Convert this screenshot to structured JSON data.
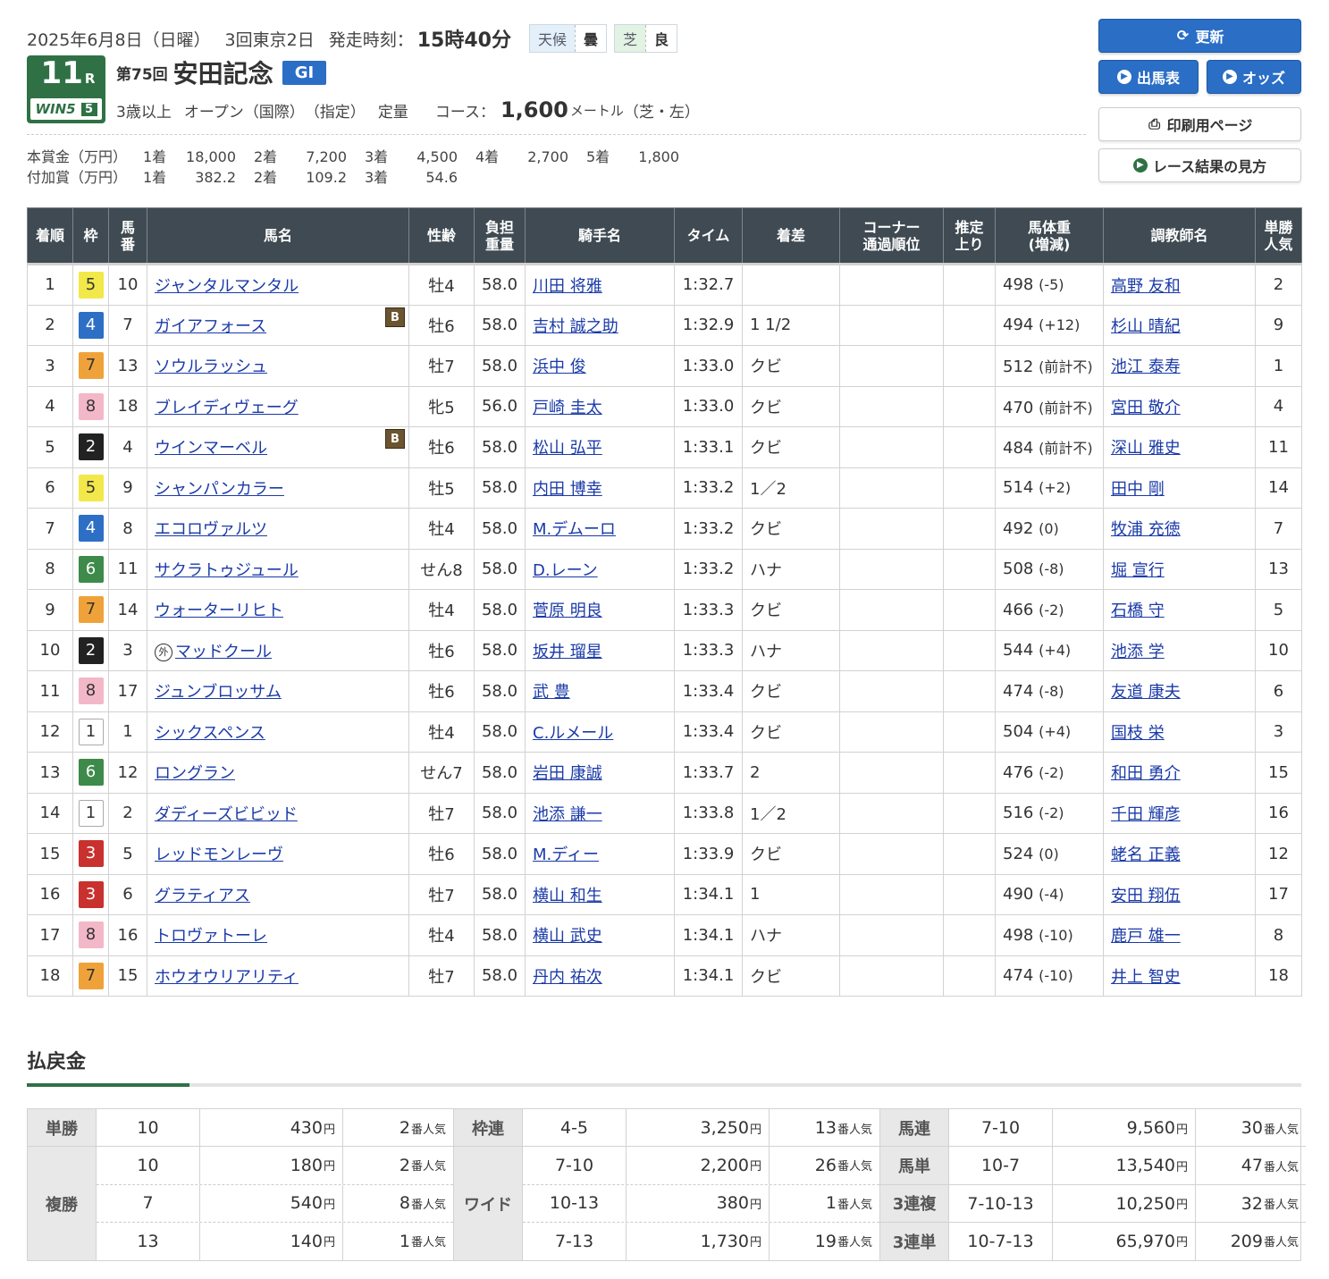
{
  "header": {
    "date": "2025年6月8日（日曜）",
    "kaisai": "3回東京2日",
    "post_label": "発走時刻：",
    "post_time": "15時40分",
    "weather_label": "天候",
    "weather_value": "曇",
    "track_label": "芝",
    "track_value": "良",
    "race_number": "11",
    "race_suffix": "R",
    "win5_label": "WIN5",
    "win5_index": "5",
    "race_kai": "第75回",
    "race_name": "安田記念",
    "grade": "GI",
    "cond_age": "3歳以上",
    "cond_class": "オープン",
    "cond_intl": "（国際）",
    "cond_shitei": "（指定）",
    "cond_weight": "定量",
    "course_label": "コース：",
    "course_distance": "1,600",
    "course_unit": "メートル",
    "course_detail": "（芝・左）"
  },
  "prize": {
    "main_label": "本賞金（万円）",
    "main": [
      {
        "place": "1着",
        "value": "18,000"
      },
      {
        "place": "2着",
        "value": "7,200"
      },
      {
        "place": "3着",
        "value": "4,500"
      },
      {
        "place": "4着",
        "value": "2,700"
      },
      {
        "place": "5着",
        "value": "1,800"
      }
    ],
    "extra_label": "付加賞（万円）",
    "extra": [
      {
        "place": "1着",
        "value": "382.2"
      },
      {
        "place": "2着",
        "value": "109.2"
      },
      {
        "place": "3着",
        "value": "54.6"
      }
    ]
  },
  "buttons": {
    "refresh": "更新",
    "entries": "出馬表",
    "odds": "オッズ",
    "print": "印刷用ページ",
    "guide": "レース結果の見方"
  },
  "table": {
    "headers": {
      "rank": "着順",
      "waku": "枠",
      "umaban_1": "馬",
      "umaban_2": "番",
      "horse": "馬名",
      "sexage": "性齢",
      "weight_1": "負担",
      "weight_2": "重量",
      "jockey": "騎手名",
      "time": "タイム",
      "margin": "着差",
      "corner_1": "コーナー",
      "corner_2": "通過順位",
      "last3f_1": "推定",
      "last3f_2": "上り",
      "body_1": "馬体重",
      "body_2": "(増減)",
      "trainer": "調教師名",
      "pop_1": "単勝",
      "pop_2": "人気"
    },
    "rows": [
      {
        "rank": "1",
        "waku": "5",
        "num": "10",
        "horse": "ジャンタルマンタル",
        "blinker": "",
        "foreign": "",
        "sexage": "牡4",
        "kg": "58.0",
        "jockey": "川田 将雅",
        "time": "1:32.7",
        "margin": "",
        "corner": "",
        "last3f": "",
        "body": "498",
        "diff": "(-5)",
        "trainer": "高野 友和",
        "pop": "2"
      },
      {
        "rank": "2",
        "waku": "4",
        "num": "7",
        "horse": "ガイアフォース",
        "blinker": "B",
        "foreign": "",
        "sexage": "牡6",
        "kg": "58.0",
        "jockey": "吉村 誠之助",
        "time": "1:32.9",
        "margin": "1 1/2",
        "corner": "",
        "last3f": "",
        "body": "494",
        "diff": "(+12)",
        "trainer": "杉山 晴紀",
        "pop": "9"
      },
      {
        "rank": "3",
        "waku": "7",
        "num": "13",
        "horse": "ソウルラッシュ",
        "blinker": "",
        "foreign": "",
        "sexage": "牡7",
        "kg": "58.0",
        "jockey": "浜中 俊",
        "time": "1:33.0",
        "margin": "クビ",
        "corner": "",
        "last3f": "",
        "body": "512",
        "diff": "(前計不)",
        "trainer": "池江 泰寿",
        "pop": "1"
      },
      {
        "rank": "4",
        "waku": "8",
        "num": "18",
        "horse": "ブレイディヴェーグ",
        "blinker": "",
        "foreign": "",
        "sexage": "牝5",
        "kg": "56.0",
        "jockey": "戸崎 圭太",
        "time": "1:33.0",
        "margin": "クビ",
        "corner": "",
        "last3f": "",
        "body": "470",
        "diff": "(前計不)",
        "trainer": "宮田 敬介",
        "pop": "4"
      },
      {
        "rank": "5",
        "waku": "2",
        "num": "4",
        "horse": "ウインマーベル",
        "blinker": "B",
        "foreign": "",
        "sexage": "牡6",
        "kg": "58.0",
        "jockey": "松山 弘平",
        "time": "1:33.1",
        "margin": "クビ",
        "corner": "",
        "last3f": "",
        "body": "484",
        "diff": "(前計不)",
        "trainer": "深山 雅史",
        "pop": "11"
      },
      {
        "rank": "6",
        "waku": "5",
        "num": "9",
        "horse": "シャンパンカラー",
        "blinker": "",
        "foreign": "",
        "sexage": "牡5",
        "kg": "58.0",
        "jockey": "内田 博幸",
        "time": "1:33.2",
        "margin": "1／2",
        "corner": "",
        "last3f": "",
        "body": "514",
        "diff": "(+2)",
        "trainer": "田中 剛",
        "pop": "14"
      },
      {
        "rank": "7",
        "waku": "4",
        "num": "8",
        "horse": "エコロヴァルツ",
        "blinker": "",
        "foreign": "",
        "sexage": "牡4",
        "kg": "58.0",
        "jockey": "M.デムーロ",
        "time": "1:33.2",
        "margin": "クビ",
        "corner": "",
        "last3f": "",
        "body": "492",
        "diff": "(0)",
        "trainer": "牧浦 充徳",
        "pop": "7"
      },
      {
        "rank": "8",
        "waku": "6",
        "num": "11",
        "horse": "サクラトゥジュール",
        "blinker": "",
        "foreign": "",
        "sexage": "せん8",
        "kg": "58.0",
        "jockey": "D.レーン",
        "time": "1:33.2",
        "margin": "ハナ",
        "corner": "",
        "last3f": "",
        "body": "508",
        "diff": "(-8)",
        "trainer": "堀 宣行",
        "pop": "13"
      },
      {
        "rank": "9",
        "waku": "7",
        "num": "14",
        "horse": "ウォーターリヒト",
        "blinker": "",
        "foreign": "",
        "sexage": "牡4",
        "kg": "58.0",
        "jockey": "菅原 明良",
        "time": "1:33.3",
        "margin": "クビ",
        "corner": "",
        "last3f": "",
        "body": "466",
        "diff": "(-2)",
        "trainer": "石橋 守",
        "pop": "5"
      },
      {
        "rank": "10",
        "waku": "2",
        "num": "3",
        "horse": "マッドクール",
        "blinker": "",
        "foreign": "外",
        "sexage": "牡6",
        "kg": "58.0",
        "jockey": "坂井 瑠星",
        "time": "1:33.3",
        "margin": "ハナ",
        "corner": "",
        "last3f": "",
        "body": "544",
        "diff": "(+4)",
        "trainer": "池添 学",
        "pop": "10"
      },
      {
        "rank": "11",
        "waku": "8",
        "num": "17",
        "horse": "ジュンブロッサム",
        "blinker": "",
        "foreign": "",
        "sexage": "牡6",
        "kg": "58.0",
        "jockey": "武 豊",
        "time": "1:33.4",
        "margin": "クビ",
        "corner": "",
        "last3f": "",
        "body": "474",
        "diff": "(-8)",
        "trainer": "友道 康夫",
        "pop": "6"
      },
      {
        "rank": "12",
        "waku": "1",
        "num": "1",
        "horse": "シックスペンス",
        "blinker": "",
        "foreign": "",
        "sexage": "牡4",
        "kg": "58.0",
        "jockey": "C.ルメール",
        "time": "1:33.4",
        "margin": "クビ",
        "corner": "",
        "last3f": "",
        "body": "504",
        "diff": "(+4)",
        "trainer": "国枝 栄",
        "pop": "3"
      },
      {
        "rank": "13",
        "waku": "6",
        "num": "12",
        "horse": "ロングラン",
        "blinker": "",
        "foreign": "",
        "sexage": "せん7",
        "kg": "58.0",
        "jockey": "岩田 康誠",
        "time": "1:33.7",
        "margin": "2",
        "corner": "",
        "last3f": "",
        "body": "476",
        "diff": "(-2)",
        "trainer": "和田 勇介",
        "pop": "15"
      },
      {
        "rank": "14",
        "waku": "1",
        "num": "2",
        "horse": "ダディーズビビッド",
        "blinker": "",
        "foreign": "",
        "sexage": "牡7",
        "kg": "58.0",
        "jockey": "池添 謙一",
        "time": "1:33.8",
        "margin": "1／2",
        "corner": "",
        "last3f": "",
        "body": "516",
        "diff": "(-2)",
        "trainer": "千田 輝彦",
        "pop": "16"
      },
      {
        "rank": "15",
        "waku": "3",
        "num": "5",
        "horse": "レッドモンレーヴ",
        "blinker": "",
        "foreign": "",
        "sexage": "牡6",
        "kg": "58.0",
        "jockey": "M.ディー",
        "time": "1:33.9",
        "margin": "クビ",
        "corner": "",
        "last3f": "",
        "body": "524",
        "diff": "(0)",
        "trainer": "蛯名 正義",
        "pop": "12"
      },
      {
        "rank": "16",
        "waku": "3",
        "num": "6",
        "horse": "グラティアス",
        "blinker": "",
        "foreign": "",
        "sexage": "牡7",
        "kg": "58.0",
        "jockey": "横山 和生",
        "time": "1:34.1",
        "margin": "1",
        "corner": "",
        "last3f": "",
        "body": "490",
        "diff": "(-4)",
        "trainer": "安田 翔伍",
        "pop": "17"
      },
      {
        "rank": "17",
        "waku": "8",
        "num": "16",
        "horse": "トロヴァトーレ",
        "blinker": "",
        "foreign": "",
        "sexage": "牡4",
        "kg": "58.0",
        "jockey": "横山 武史",
        "time": "1:34.1",
        "margin": "ハナ",
        "corner": "",
        "last3f": "",
        "body": "498",
        "diff": "(-10)",
        "trainer": "鹿戸 雄一",
        "pop": "8"
      },
      {
        "rank": "18",
        "waku": "7",
        "num": "15",
        "horse": "ホウオウリアリティ",
        "blinker": "",
        "foreign": "",
        "sexage": "牡7",
        "kg": "58.0",
        "jockey": "丹内 祐次",
        "time": "1:34.1",
        "margin": "クビ",
        "corner": "",
        "last3f": "",
        "body": "474",
        "diff": "(-10)",
        "trainer": "井上 智史",
        "pop": "18"
      }
    ]
  },
  "payout": {
    "title": "払戻金",
    "yen": "円",
    "ninki": "番人気",
    "tansho": {
      "label": "単勝",
      "rows": [
        {
          "num": "10",
          "amt": "430",
          "pop": "2"
        }
      ]
    },
    "fukusho": {
      "label": "複勝",
      "rows": [
        {
          "num": "10",
          "amt": "180",
          "pop": "2"
        },
        {
          "num": "7",
          "amt": "540",
          "pop": "8"
        },
        {
          "num": "13",
          "amt": "140",
          "pop": "1"
        }
      ]
    },
    "wakuren": {
      "label": "枠連",
      "rows": [
        {
          "num": "4-5",
          "amt": "3,250",
          "pop": "13"
        }
      ]
    },
    "wide": {
      "label": "ワイド",
      "rows": [
        {
          "num": "7-10",
          "amt": "2,200",
          "pop": "26"
        },
        {
          "num": "10-13",
          "amt": "380",
          "pop": "1"
        },
        {
          "num": "7-13",
          "amt": "1,730",
          "pop": "19"
        }
      ]
    },
    "umaren": {
      "label": "馬連",
      "rows": [
        {
          "num": "7-10",
          "amt": "9,560",
          "pop": "30"
        }
      ]
    },
    "umatan": {
      "label": "馬単",
      "rows": [
        {
          "num": "10-7",
          "amt": "13,540",
          "pop": "47"
        }
      ]
    },
    "sanrenpuku": {
      "label": "3連複",
      "rows": [
        {
          "num": "7-10-13",
          "amt": "10,250",
          "pop": "32"
        }
      ]
    },
    "sanrentan": {
      "label": "3連単",
      "rows": [
        {
          "num": "10-7-13",
          "amt": "65,970",
          "pop": "209"
        }
      ]
    }
  }
}
